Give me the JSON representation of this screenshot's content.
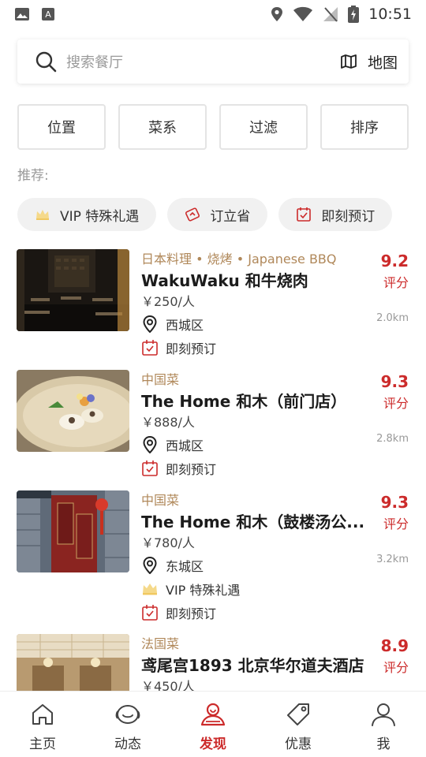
{
  "status_bar": {
    "time": "10:51"
  },
  "search": {
    "placeholder": "搜索餐厅",
    "map_label": "地图"
  },
  "filters": [
    "位置",
    "菜系",
    "过滤",
    "排序"
  ],
  "recommend_label": "推荐:",
  "chips": [
    {
      "label": "VIP 特殊礼遇",
      "icon": "crown-icon"
    },
    {
      "label": "订立省",
      "icon": "coupon-icon"
    },
    {
      "label": "即刻预订",
      "icon": "calendar-check-icon"
    }
  ],
  "restaurants": [
    {
      "cuisine": "日本料理 • 烧烤 • Japanese BBQ",
      "name": "WakuWaku 和牛烧肉",
      "price": "￥250/人",
      "district": "西城区",
      "distance": "2.0km",
      "score": "9.2",
      "score_label": "评分",
      "tags": [
        "即刻预订"
      ]
    },
    {
      "cuisine": "中国菜",
      "name": "The Home 和木（前门店）",
      "price": "￥888/人",
      "district": "西城区",
      "distance": "2.8km",
      "score": "9.3",
      "score_label": "评分",
      "tags": [
        "即刻预订"
      ]
    },
    {
      "cuisine": "中国菜",
      "name": "The Home 和木（鼓楼汤公...",
      "price": "￥780/人",
      "district": "东城区",
      "distance": "3.2km",
      "score": "9.3",
      "score_label": "评分",
      "vip_tag": "VIP 特殊礼遇",
      "tags": [
        "即刻预订"
      ]
    },
    {
      "cuisine": "法国菜",
      "name": "鸢尾宫1893 北京华尔道夫酒店",
      "price": "￥450/人",
      "score": "8.9",
      "score_label": "评分"
    }
  ],
  "bottom_nav": [
    {
      "label": "主页",
      "icon": "home-icon"
    },
    {
      "label": "动态",
      "icon": "feed-icon"
    },
    {
      "label": "发现",
      "icon": "discover-icon",
      "active": true
    },
    {
      "label": "优惠",
      "icon": "tag-icon"
    },
    {
      "label": "我",
      "icon": "profile-icon"
    }
  ],
  "colors": {
    "accent": "#cc2b2b",
    "cuisine": "#b0885a",
    "muted": "#9a9a9a"
  }
}
